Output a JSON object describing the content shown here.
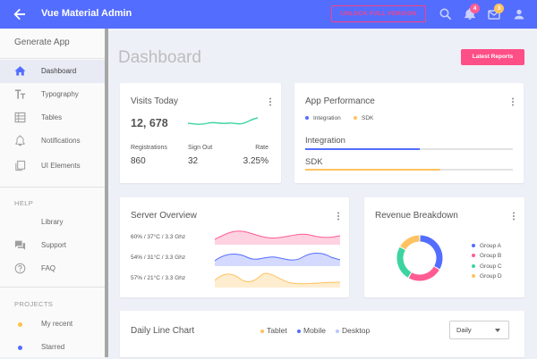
{
  "header": {
    "app_title": "Vue Material Admin",
    "unlock_label": "UNLOCK FULL VERSION",
    "notification_count": "4",
    "mail_count": "3"
  },
  "sidebar": {
    "app_label": "Generate App",
    "items": [
      {
        "label": "Dashboard",
        "icon": "home-icon"
      },
      {
        "label": "Typography",
        "icon": "text-format-icon"
      },
      {
        "label": "Tables",
        "icon": "table-grid-icon"
      },
      {
        "label": "Notifications",
        "icon": "bell-icon"
      },
      {
        "label": "UI Elements",
        "icon": "copy-icon"
      }
    ],
    "help_title": "HELP",
    "help_items": [
      {
        "label": "Library",
        "icon": ""
      },
      {
        "label": "Support",
        "icon": "forum-icon"
      },
      {
        "label": "FAQ",
        "icon": "help-circle-icon"
      }
    ],
    "projects_title": "PROJECTS",
    "projects": [
      {
        "label": "My recent",
        "color": "#ffc247"
      },
      {
        "label": "Starred",
        "color": "#536dfe"
      }
    ]
  },
  "main": {
    "title": "Dashboard",
    "latest_reports": "Latest Reports"
  },
  "visits": {
    "title": "Visits Today",
    "value": "12, 678",
    "stats": [
      {
        "label": "Registrations",
        "value": "860"
      },
      {
        "label": "Sign Out",
        "value": "32"
      },
      {
        "label": "Rate",
        "value": "3.25%"
      }
    ],
    "line_color": "#3cd4a0"
  },
  "performance": {
    "title": "App Performance",
    "legend": [
      {
        "label": "Integration",
        "color": "#536dfe"
      },
      {
        "label": "SDK",
        "color": "#ffc260"
      }
    ],
    "bars": [
      {
        "label": "Integration",
        "progress": 0.55,
        "color": "#536dfe"
      },
      {
        "label": "SDK",
        "progress": 0.65,
        "color": "#ffc260"
      }
    ]
  },
  "server": {
    "title": "Server Overview",
    "rows": [
      {
        "label": "60% / 37°C / 3.3 Ghz",
        "color": "#ff5c93"
      },
      {
        "label": "54% / 31°C / 3.3 Ghz",
        "color": "#536dfe"
      },
      {
        "label": "57% / 21°C / 3.3 Ghz",
        "color": "#ffc260"
      }
    ]
  },
  "revenue": {
    "title": "Revenue Breakdown",
    "groups": [
      {
        "label": "Group A",
        "value": 400,
        "color": "#536dfe"
      },
      {
        "label": "Group B",
        "value": 300,
        "color": "#ff5c93"
      },
      {
        "label": "Group C",
        "value": 300,
        "color": "#3cd4a0"
      },
      {
        "label": "Group D",
        "value": 200,
        "color": "#ffc260"
      }
    ]
  },
  "daily": {
    "title": "Daily Line Chart",
    "legend": [
      {
        "label": "Tablet",
        "color": "#ffc260"
      },
      {
        "label": "Mobile",
        "color": "#536dfe"
      },
      {
        "label": "Desktop",
        "color": "#b8c6ff"
      }
    ],
    "select_value": "Daily"
  }
}
